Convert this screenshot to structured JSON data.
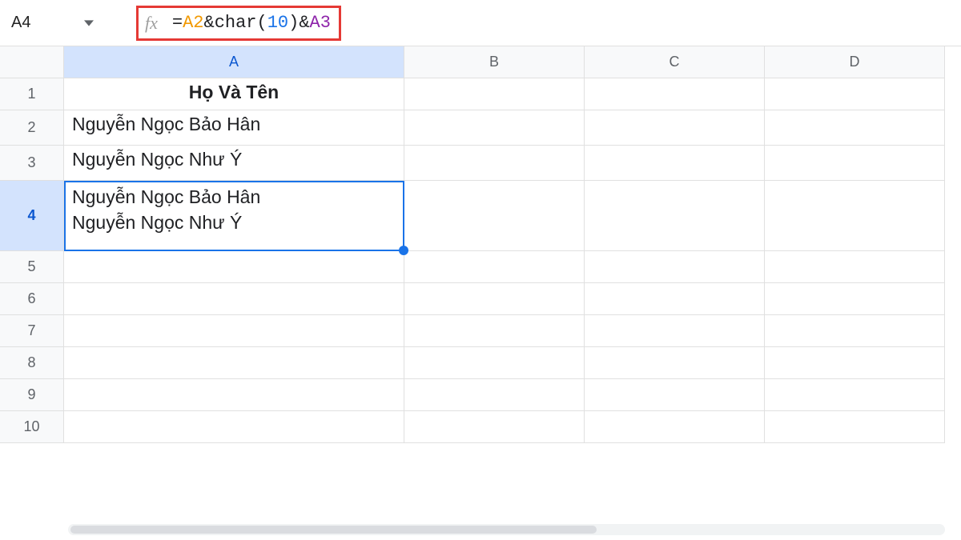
{
  "formula_bar": {
    "cell_ref": "A4",
    "fx_label": "fx",
    "formula": {
      "tokens": {
        "eq": "=",
        "ref1": "A2",
        "amp1": "&",
        "func": "char",
        "lparen": "(",
        "num": "10",
        "rparen": ")",
        "amp2": "&",
        "ref2": "A3"
      }
    }
  },
  "columns": [
    "A",
    "B",
    "C",
    "D"
  ],
  "rows": [
    "1",
    "2",
    "3",
    "4",
    "5",
    "6",
    "7",
    "8",
    "9",
    "10"
  ],
  "active_cell": "A4",
  "cells": {
    "A1": "Họ Và Tên",
    "A2": "Nguyễn Ngọc Bảo Hân",
    "A3": "Nguyễn Ngọc Như Ý",
    "A4_line1": "Nguyễn Ngọc Bảo Hân",
    "A4_line2": "Nguyễn Ngọc Như Ý"
  }
}
